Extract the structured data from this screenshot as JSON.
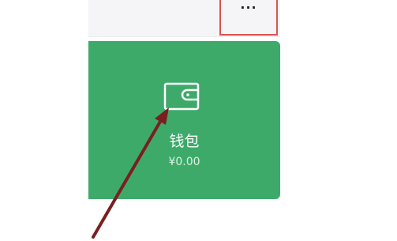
{
  "header": {
    "more_label": "···"
  },
  "wallet_card": {
    "label": "钱包",
    "balance": "¥0.00",
    "icon": "wallet-icon",
    "background_color": "#3daa6a"
  },
  "annotation": {
    "arrow_color": "#7a1f1f",
    "highlight_color": "#d9534f"
  }
}
